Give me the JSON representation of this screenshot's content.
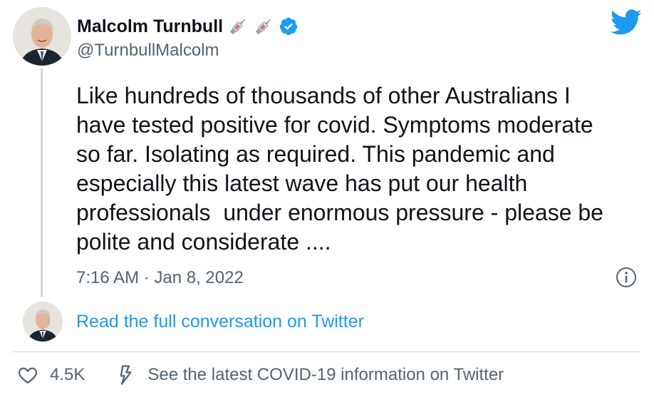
{
  "author": {
    "name": "Malcolm Turnbull",
    "handle": "@TurnbullMalcolm",
    "name_emojis": [
      "syringe-icon",
      "syringe-icon"
    ],
    "verified": true
  },
  "tweet": {
    "text": "Like hundreds of thousands of other Australians I\nhave tested positive for covid. Symptoms moderate\nso far. Isolating as required. This pandemic and\nespecially this latest wave has put our health\nprofessionals  under enormous pressure - please be\npolite and considerate ....",
    "timestamp": "7:16 AM · Jan 8, 2022"
  },
  "conversation": {
    "link_text": "Read the full conversation on Twitter"
  },
  "footer": {
    "like_count": "4.5K",
    "info_link": "See the latest COVID-19 information on Twitter"
  },
  "colors": {
    "twitter_blue": "#1d9bf0",
    "text_primary": "#0f1419",
    "text_secondary": "#536471",
    "divider": "#cfd9de"
  }
}
